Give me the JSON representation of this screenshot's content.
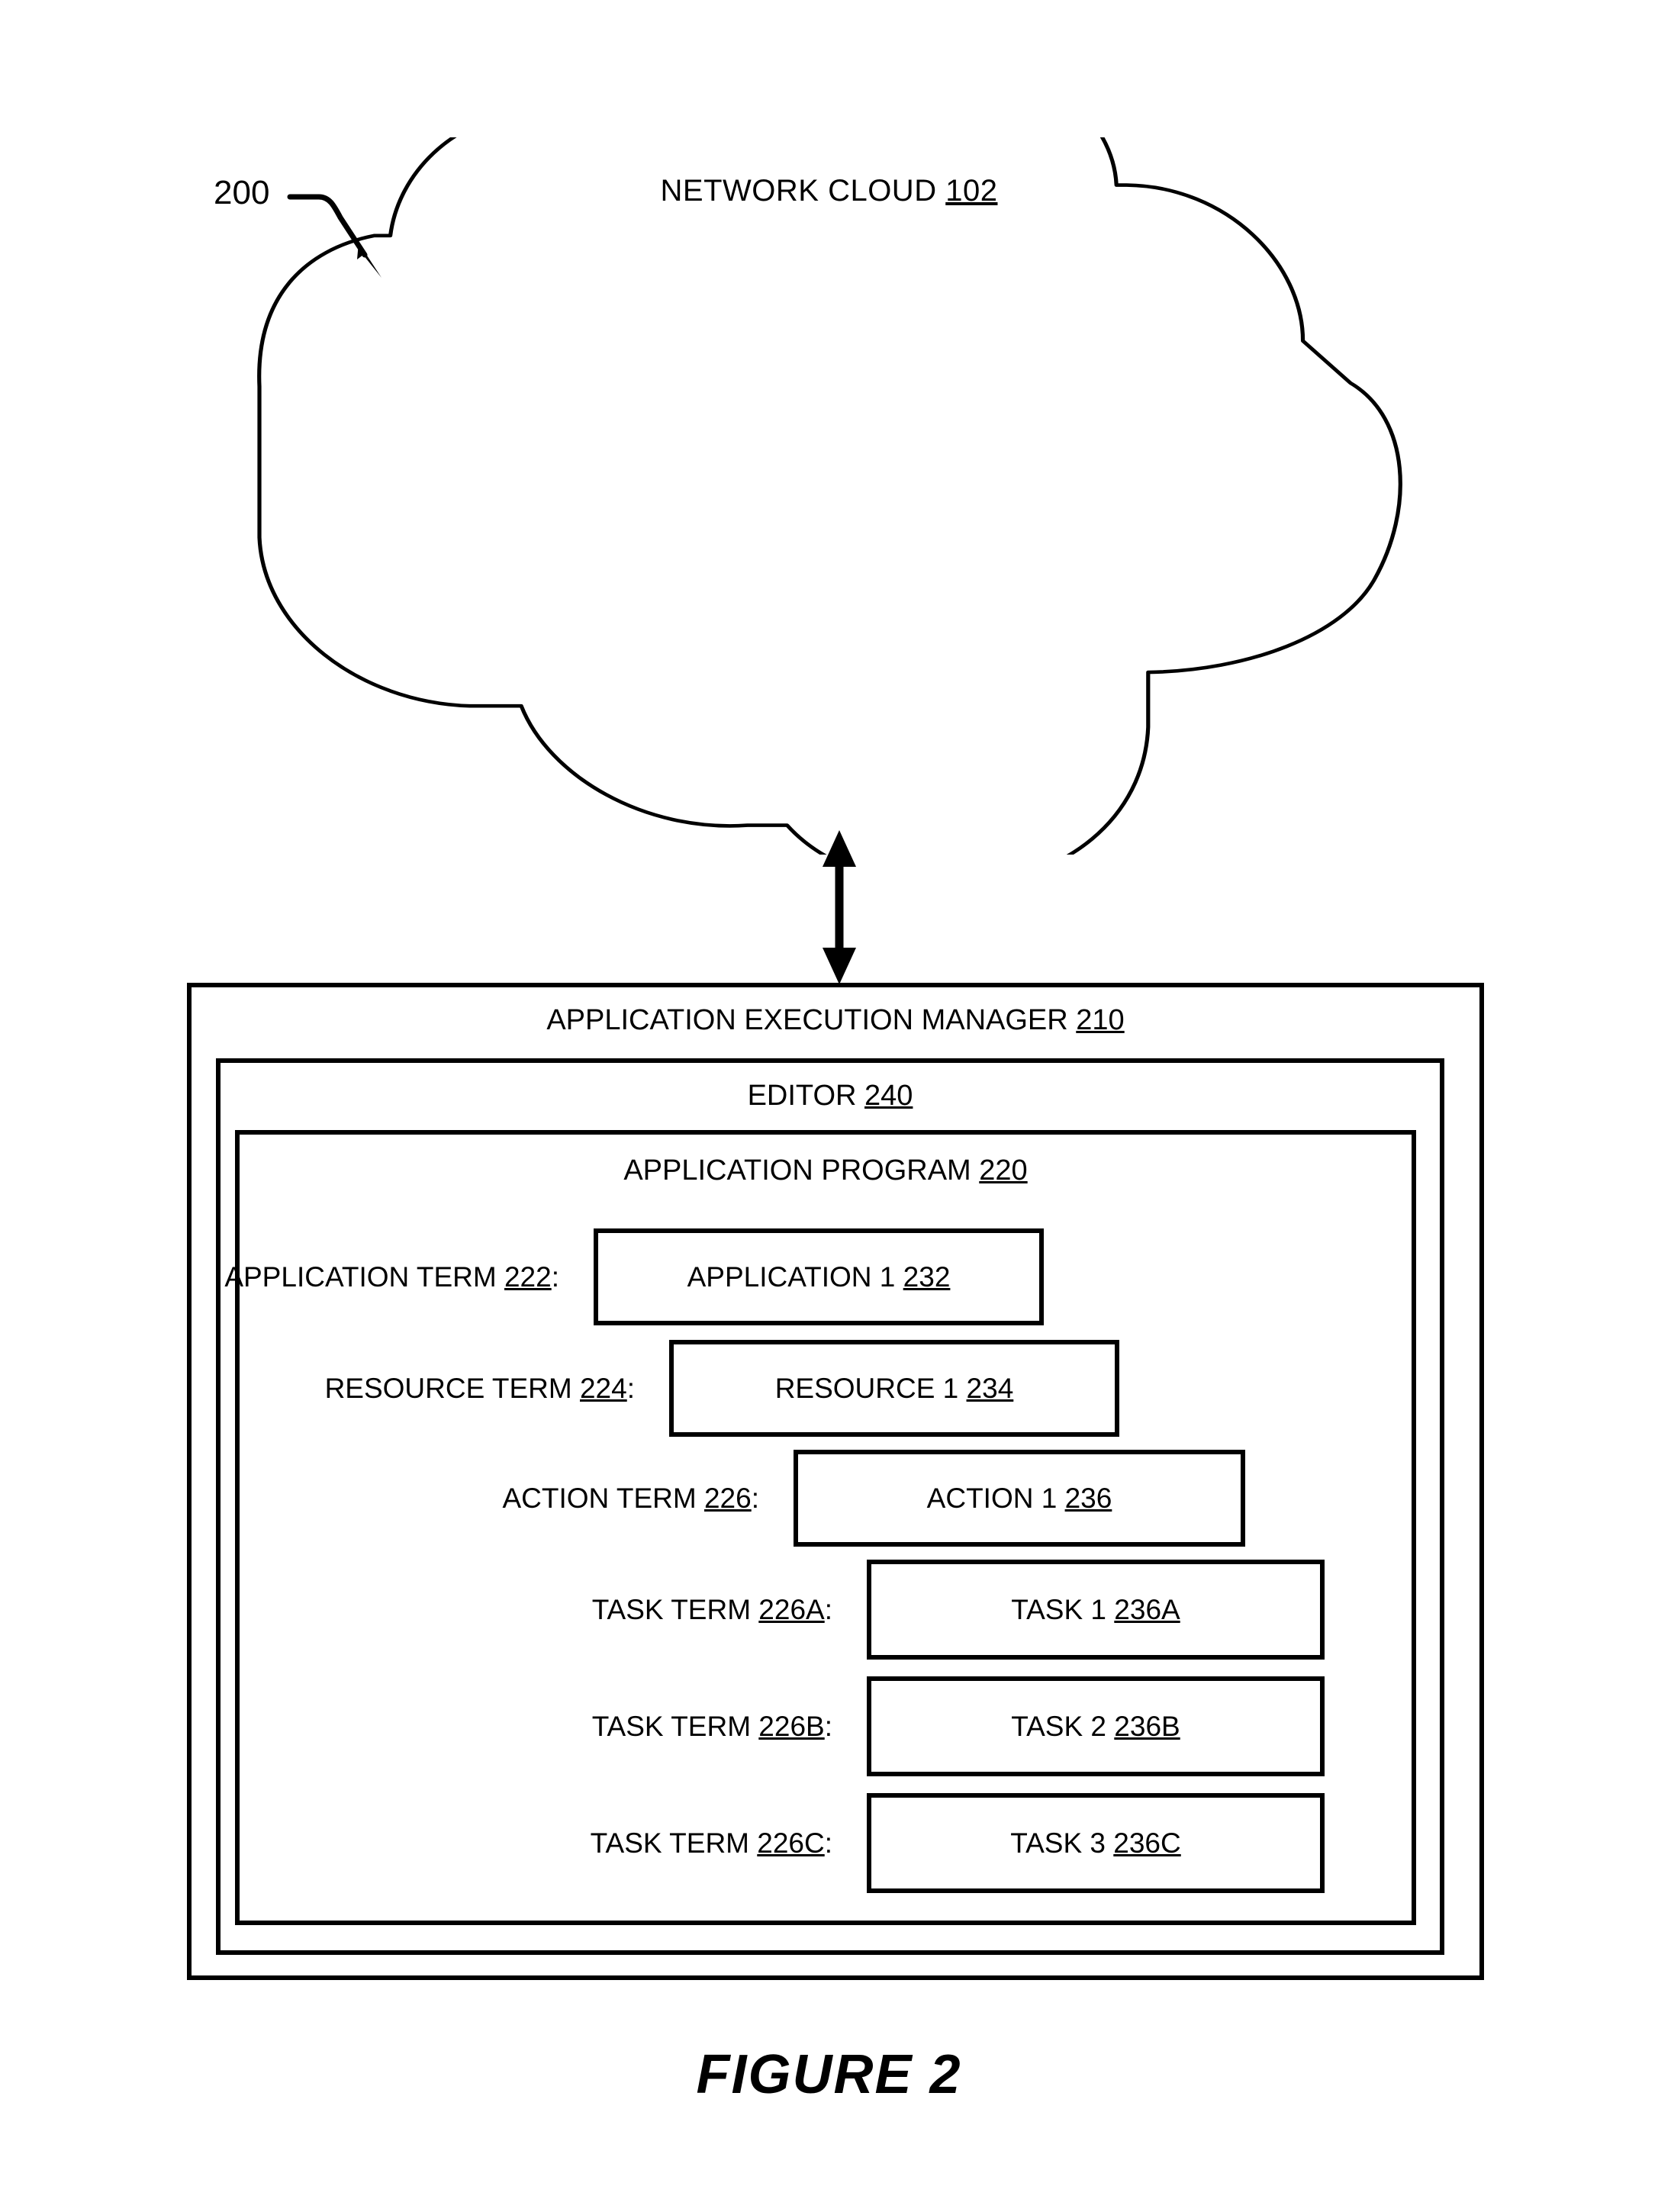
{
  "figure": {
    "caption": "FIGURE 2",
    "ref_numeral": "200"
  },
  "cloud": {
    "label": "NETWORK CLOUD",
    "number": "102"
  },
  "panels": {
    "manager": {
      "label": "APPLICATION EXECUTION MANAGER",
      "number": "210"
    },
    "editor": {
      "label": "EDITOR",
      "number": "240"
    },
    "program": {
      "label": "APPLICATION PROGRAM",
      "number": "220"
    }
  },
  "terms": [
    {
      "label": "APPLICATION TERM",
      "label_number": "222",
      "label_suffix": ":",
      "box_label": "APPLICATION 1",
      "box_number": "232"
    },
    {
      "label": "RESOURCE TERM",
      "label_number": "224",
      "label_suffix": ":",
      "box_label": "RESOURCE 1",
      "box_number": "234"
    },
    {
      "label": "ACTION TERM",
      "label_number": "226",
      "label_suffix": ":",
      "box_label": "ACTION 1",
      "box_number": "236"
    },
    {
      "label": "TASK TERM",
      "label_number": "226A",
      "label_suffix": ":",
      "box_label": "TASK 1",
      "box_number": "236A"
    },
    {
      "label": "TASK TERM",
      "label_number": "226B",
      "label_suffix": ":",
      "box_label": "TASK 2",
      "box_number": "236B"
    },
    {
      "label": "TASK TERM",
      "label_number": "226C",
      "label_suffix": ":",
      "box_label": "TASK 3",
      "box_number": "236C"
    }
  ],
  "connector": {
    "name": "bidirectional-arrow",
    "from": "network-cloud",
    "to": "application-execution-manager"
  },
  "colors": {
    "line": "#000000",
    "background": "#ffffff"
  }
}
